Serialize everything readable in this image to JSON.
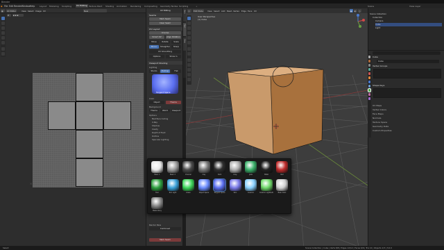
{
  "app": {
    "title": "Blender"
  },
  "menu": {
    "items": [
      "File",
      "Edit",
      "Render",
      "Window",
      "Help"
    ],
    "workspaces": [
      "Layout",
      "Modeling",
      "Sculpting",
      "UV Editing",
      "Texture Paint",
      "Shading",
      "Animation",
      "Rendering",
      "Compositing",
      "Geometry Nodes",
      "Scripting"
    ],
    "active_workspace": "UV Editing",
    "scene": "Scene",
    "view_layer": "View Layer"
  },
  "uv_editor": {
    "mode": "UV Editor",
    "menus": [
      "View",
      "Select",
      "Image",
      "UV"
    ],
    "image_name": "New"
  },
  "npanel": {
    "tabs": [
      "Item",
      "Tool",
      "View"
    ],
    "header": "UV Editing",
    "sections": {
      "seams": "Seams",
      "mark_seam": "Mark Seam",
      "clear_seam": "Clear Seam",
      "uv_layout": "UV Layout",
      "unwrap": "Unwrap",
      "smart_uv": "Smart UV",
      "align_rotation": "Align Rotation",
      "move": "Move",
      "rotate": "Rotate",
      "scale": "Scale",
      "mirror": "Mirror",
      "straighten": "Straighten",
      "uv_smoothing": "UV Smoothing",
      "options": "Options",
      "sharp": "Sharp",
      "show_in": "Show In",
      "viewport_shading": "Viewport Shading",
      "lighting": "Lighting",
      "studio": "Studio",
      "matcap": "MatCap",
      "flat": "Flat",
      "selected_matcap": "Tangent Space",
      "color": "Color",
      "object": "Object",
      "background": "Background",
      "theme": "Theme",
      "world": "World",
      "viewport": "Viewport",
      "options2": "Options",
      "backface": "Backface Culling",
      "outline": "Outline",
      "xray": "X-Ray",
      "shadow": "Shadow",
      "cavity": "Cavity",
      "depth": "Depth of Field",
      "specular": "Specular Lighting",
      "render_pass": "Render Pass",
      "combined": "Combined"
    }
  },
  "matcaps": {
    "items": [
      {
        "label": "Basic 1",
        "color": "#e8e8e8"
      },
      {
        "label": "Basic 2",
        "color": "#9c9c9c"
      },
      {
        "label": "Checker",
        "color": "#4a4a4a"
      },
      {
        "label": "Clay",
        "color": "#777777"
      },
      {
        "label": "Dark",
        "color": "#2f2f2f"
      },
      {
        "label": "Gray",
        "color": "#b0b0b0"
      },
      {
        "label": "Jade",
        "color": "#3bb06a"
      },
      {
        "label": "Metal",
        "color": "#222222"
      },
      {
        "label": "Red",
        "color": "#c02c2c"
      },
      {
        "label": "Toon",
        "color": "#2ea040"
      },
      {
        "label": "Rim Light",
        "color": "#3aa0d8"
      },
      {
        "label": "Green",
        "color": "#3dd65a"
      },
      {
        "label": "Object Space",
        "color": "#6a8cff"
      },
      {
        "label": "Tangent Space",
        "color": "#5a6ef0"
      },
      {
        "label": "Skin",
        "color": "#7a7ae8"
      },
      {
        "label": "Ceramic",
        "color": "#8ad0ff"
      },
      {
        "label": "Ceramic Lightbulb",
        "color": "#6fd86a"
      },
      {
        "label": "Basic Dark",
        "color": "#d0d0d0"
      },
      {
        "label": "Metal Shiny",
        "color": "#8a8a8a"
      }
    ],
    "selected": "Tangent Space"
  },
  "viewport": {
    "mode": "Edit Mode",
    "menus": [
      "View",
      "Select",
      "Add",
      "Mesh",
      "Vertex",
      "Edge",
      "Face",
      "UV"
    ],
    "overlay_title": "User Perspective",
    "overlay_object": "(1) Cube",
    "cube_color": "#c99a6b"
  },
  "outliner": {
    "rows": [
      {
        "label": "Scene Collection",
        "selected": false
      },
      {
        "label": "Collection",
        "selected": false
      },
      {
        "label": "Camera",
        "selected": false
      },
      {
        "label": "Cube",
        "selected": true
      },
      {
        "label": "Light",
        "selected": false
      }
    ]
  },
  "properties": {
    "search_placeholder": "",
    "object_label": "Cube",
    "mesh_label": "Cube",
    "sections": [
      "Vertex Groups",
      "Shape Keys"
    ],
    "collapsed": [
      "UV Maps",
      "Vertex Colors",
      "Face Maps",
      "Normals",
      "Texture Space",
      "Geometry Data",
      "Custom Properties"
    ]
  },
  "status": {
    "left": "Select",
    "right": "Scene Collection | Cube | Verts 8/8 | Edges 12/12 | Faces 6/6 | Tris 12 | Objects 1/3 | 3.0.0"
  }
}
